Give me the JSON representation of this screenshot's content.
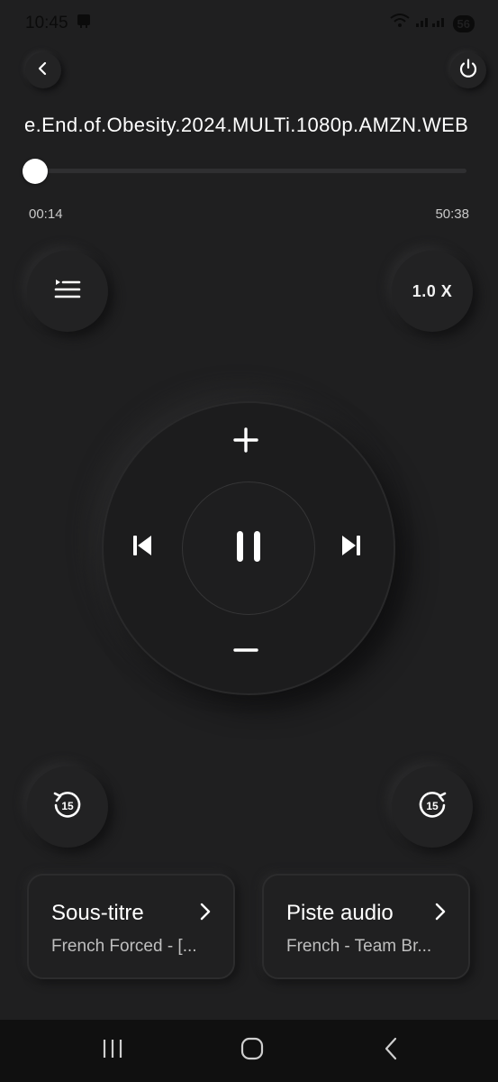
{
  "status_bar": {
    "time": "10:45",
    "battery": "56"
  },
  "player": {
    "title": "e.End.of.Obesity.2024.MULTi.1080p.AMZN.WEB",
    "elapsed": "00:14",
    "duration": "50:38",
    "progress_fraction": 0.0046,
    "speed": "1.0 X"
  },
  "tracks": {
    "subtitle_label": "Sous-titre",
    "subtitle_value": "French Forced - [...",
    "audio_label": "Piste audio",
    "audio_value": "French - Team Br..."
  },
  "icons": {
    "back": "chevron-left-icon",
    "power": "power-icon",
    "playlist": "playlist-icon",
    "volume_up": "plus-icon",
    "volume_down": "minus-icon",
    "previous": "skip-previous-icon",
    "next": "skip-next-icon",
    "pause": "pause-icon",
    "rewind": "replay-15-icon",
    "forward": "forward-15-icon",
    "skip_seconds": "15"
  },
  "colors": {
    "background": "#1f1f20",
    "accent": "#ffffff",
    "secondary_text": "#bfbfbf"
  }
}
